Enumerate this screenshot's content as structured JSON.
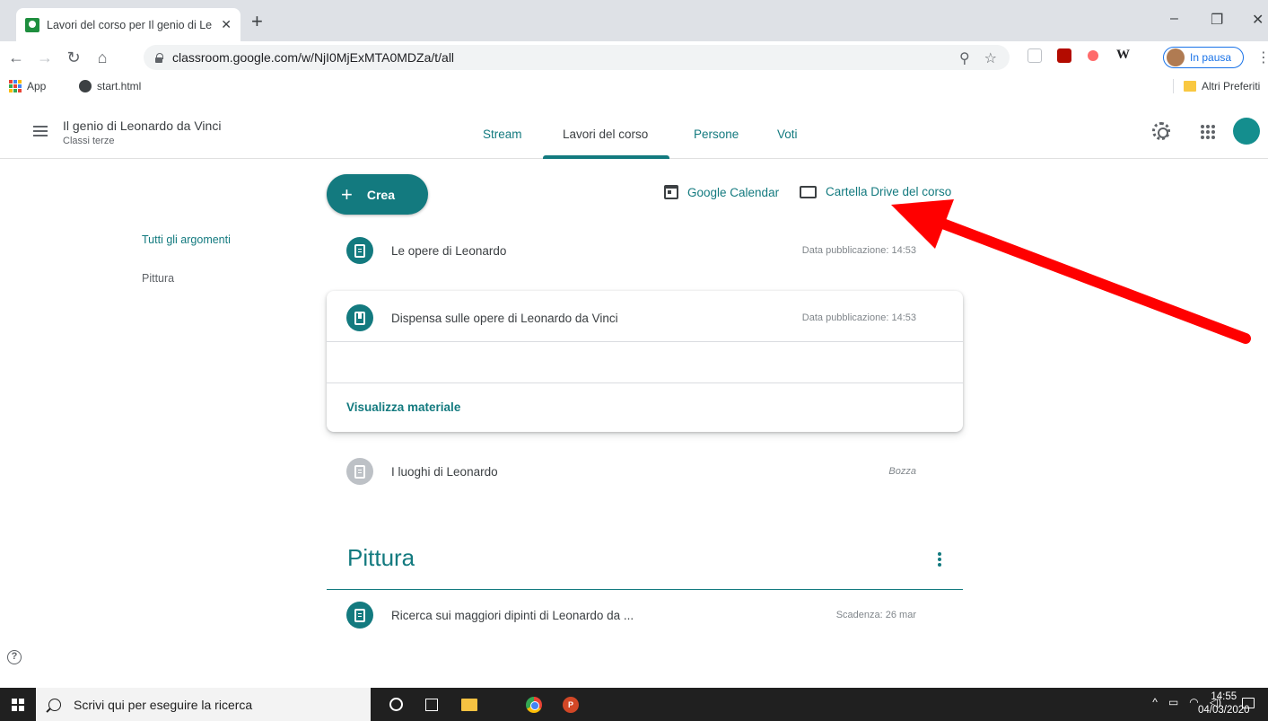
{
  "browser": {
    "tab_title": "Lavori del corso per Il genio di Le",
    "tab_close": "✕",
    "new_tab": "+",
    "url": "classroom.google.com/w/NjI0MjExMTA0MDZa/t/all",
    "profile_status": "In pausa",
    "window_controls": [
      "–",
      "❐",
      "✕"
    ],
    "bookmarks": [
      "App",
      "start.html"
    ],
    "bookmarks_right": "Altri Preferiti"
  },
  "classroom": {
    "course_title": "Il genio di Leonardo da Vinci",
    "course_section": "Classi terze",
    "tabs": [
      "Stream",
      "Lavori del corso",
      "Persone",
      "Voti"
    ],
    "active_tab": "Lavori del corso",
    "create_label": "Crea",
    "calendar_link": "Google Calendar",
    "drive_link": "Cartella Drive del corso",
    "topics_sidebar": [
      "Tutti gli argomenti",
      "Pittura"
    ],
    "items": [
      {
        "title": "Le opere di Leonardo",
        "meta": "Data pubblicazione: 14:53"
      },
      {
        "title": "Dispensa sulle opere di Leonardo da Vinci",
        "meta": "Data pubblicazione: 14:53"
      },
      {
        "title": "I luoghi di Leonardo",
        "meta": "Bozza"
      }
    ],
    "view_material": "Visualizza materiale",
    "topic_heading": "Pittura",
    "topic_items": [
      {
        "title": "Ricerca sui maggiori dipinti di Leonardo da ...",
        "meta": "Scadenza: 26 mar"
      }
    ],
    "help": "?"
  },
  "colors": {
    "accent": "#137a7f",
    "arrow": "#ff0000"
  },
  "taskbar": {
    "search_placeholder": "Scrivi qui per eseguire la ricerca",
    "time": "14:55",
    "date": "04/03/2020",
    "ppt_letter": "P"
  }
}
